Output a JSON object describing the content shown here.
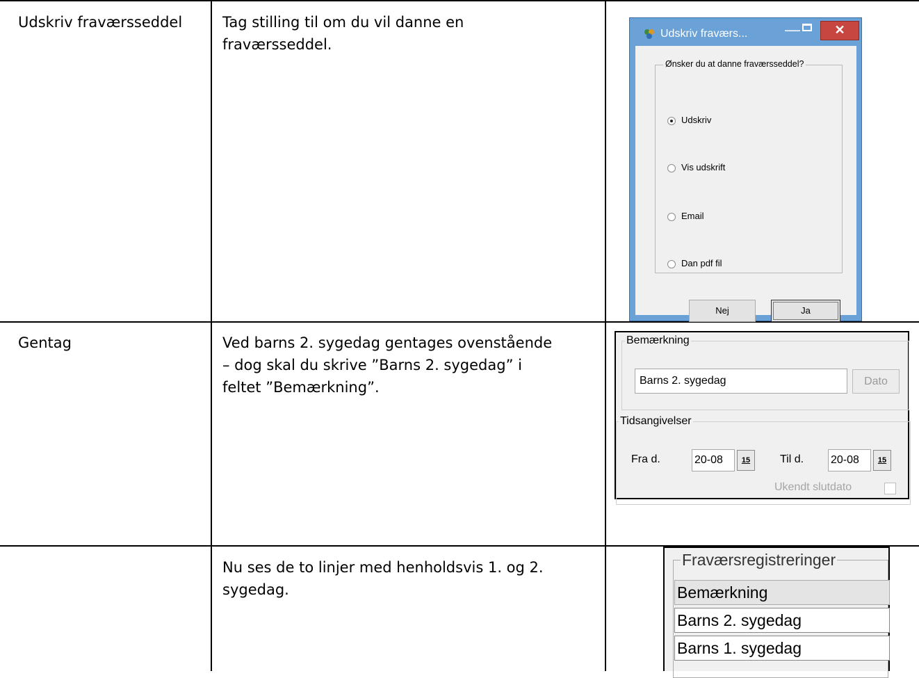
{
  "rows": [
    {
      "col1": "Udskriv fraværsseddel",
      "col2": "Tag stilling til om du vil danne en\nfraværsseddel."
    },
    {
      "col1": "Gentag",
      "col2": "Ved barns 2. sygedag gentages ovenstående\n– dog skal du skrive ”Barns 2. sygedag” i\nfeltet ”Bemærkning”."
    },
    {
      "col1": "",
      "col2": "Nu ses de to linjer med henholdsvis 1. og 2.\nsygedag."
    }
  ],
  "dialog": {
    "title": "Udskriv fravær s...",
    "title_display": "Udskriv fraværs...",
    "minimize": "—",
    "close": "✕",
    "group_label": "Ønsker du at danne fraværsseddel?",
    "options": [
      {
        "label": "Udskriv",
        "checked": true
      },
      {
        "label": "Vis udskrift",
        "checked": false
      },
      {
        "label": "Email",
        "checked": false
      },
      {
        "label": "Dan pdf fil",
        "checked": false
      }
    ],
    "btn_no": "Nej",
    "btn_yes": "Ja"
  },
  "panel": {
    "remark_legend": "Bemærkning",
    "remark_value": "Barns 2. sygedag",
    "date_button": "Dato",
    "time_legend": "Tidsangivelser",
    "from_label": "Fra d.",
    "from_value": "20-08",
    "to_label": "Til d.",
    "to_value": "20-08",
    "cal_icon_text": "15",
    "unknown_end": "Ukendt slutdato"
  },
  "list": {
    "legend": "Fraværsregistreringer",
    "header": "Bemærkning",
    "items": [
      "Barns 2. sygedag",
      "Barns 1. sygedag"
    ]
  }
}
